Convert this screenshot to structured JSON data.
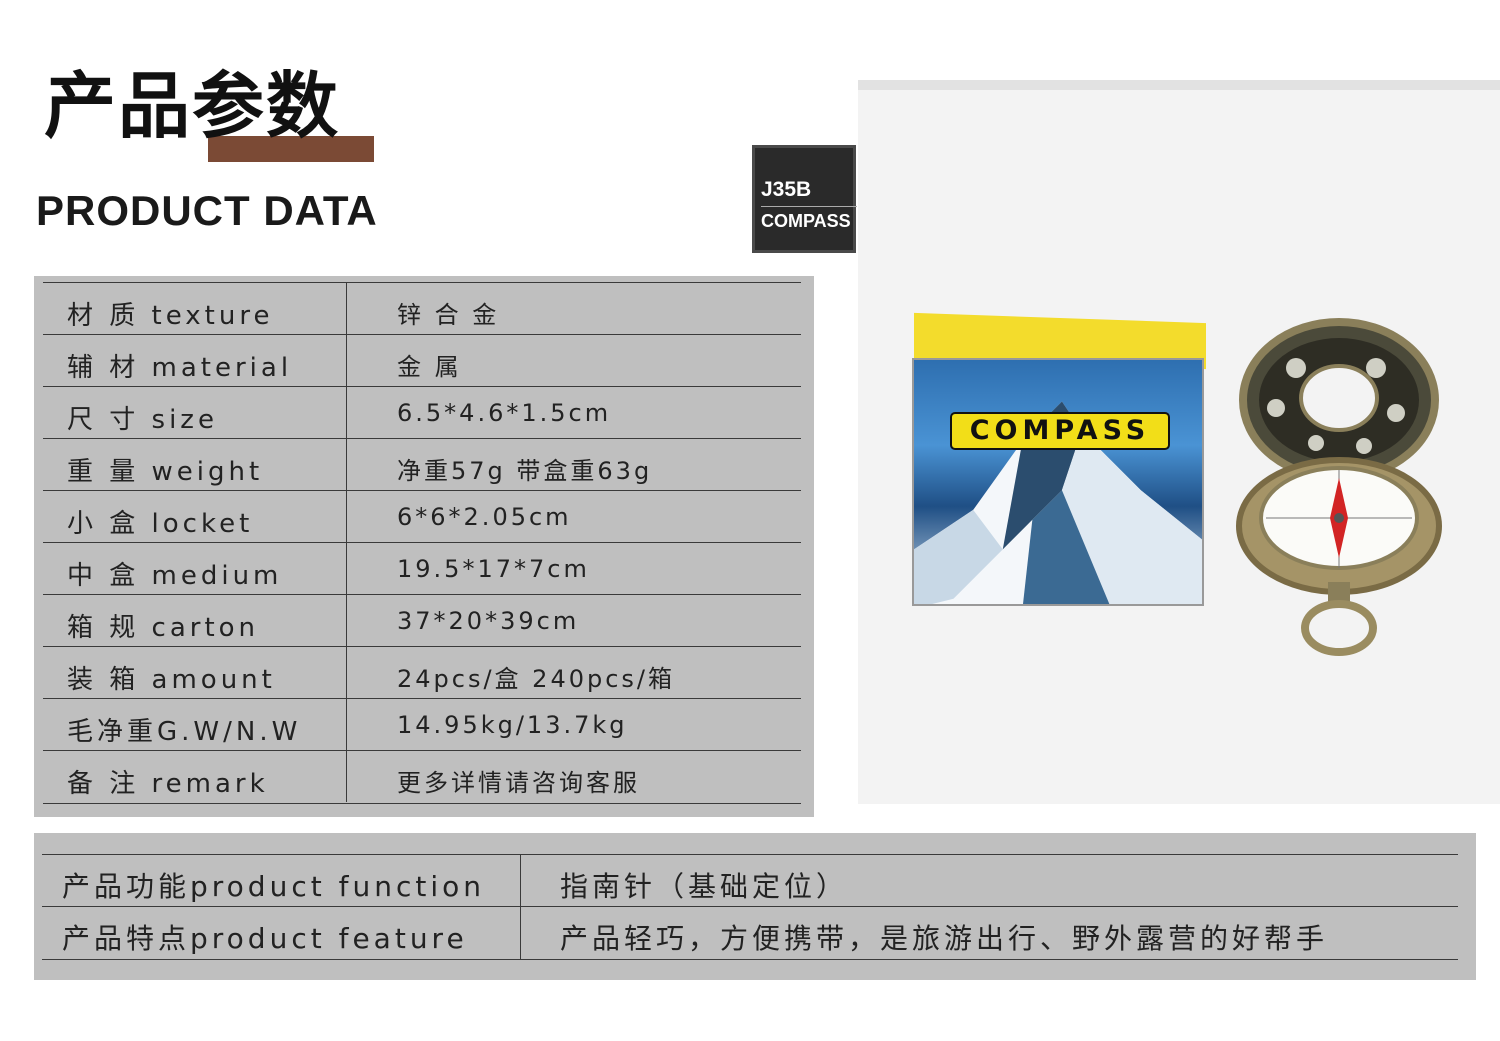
{
  "header": {
    "title_cn": "产品参数",
    "title_en": "PRODUCT DATA"
  },
  "badge": {
    "model": "J35B",
    "kind": "COMPASS"
  },
  "specs": [
    {
      "label": "材 质 texture",
      "value": "锌 合 金"
    },
    {
      "label": "辅 材 material",
      "value": "金 属"
    },
    {
      "label": "尺 寸 size",
      "value": "6.5*4.6*1.5cm"
    },
    {
      "label": "重 量 weight",
      "value": "净重57g   带盒重63g"
    },
    {
      "label": "小 盒 locket",
      "value": "6*6*2.05cm"
    },
    {
      "label": "中 盒 medium",
      "value": "19.5*17*7cm"
    },
    {
      "label": "箱 规 carton",
      "value": "37*20*39cm"
    },
    {
      "label": "装 箱 amount",
      "value": "24pcs/盒 240pcs/箱"
    },
    {
      "label": "毛净重G.W/N.W",
      "value": "14.95kg/13.7kg"
    },
    {
      "label": "备 注 remark",
      "value": "更多详情请咨询客服"
    }
  ],
  "photo": {
    "box_label": "COMPASS"
  },
  "features": [
    {
      "label": "产品功能product function",
      "value": "指南针（基础定位）"
    },
    {
      "label": "产品特点product feature",
      "value": "产品轻巧，方便携带，是旅游出行、野外露营的好帮手"
    }
  ]
}
